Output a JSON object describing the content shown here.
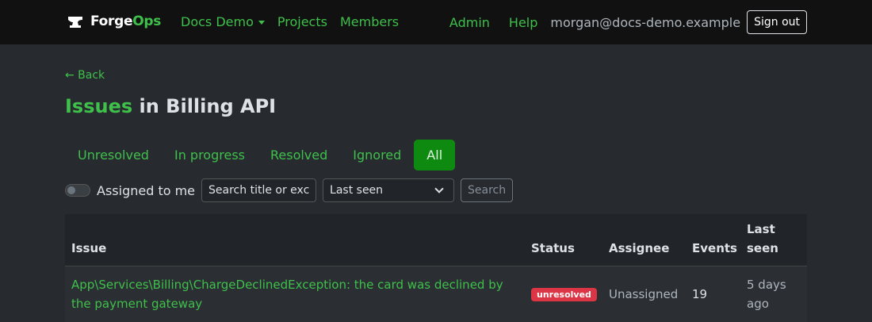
{
  "brand": {
    "name_a": "Forge",
    "name_b": "Ops"
  },
  "nav": {
    "workspace": "Docs Demo",
    "projects": "Projects",
    "members": "Members",
    "admin": "Admin",
    "help": "Help",
    "user_email": "morgan@docs-demo.example",
    "sign_out": "Sign out"
  },
  "back_label": "← Back",
  "title": {
    "highlight": "Issues",
    "rest": " in Billing API"
  },
  "tabs": [
    "Unresolved",
    "In progress",
    "Resolved",
    "Ignored",
    "All"
  ],
  "active_tab": "All",
  "filters": {
    "assigned_label": "Assigned to me",
    "search_placeholder": "Search title or exce",
    "sort_selected": "Last seen",
    "search_button": "Search"
  },
  "table": {
    "headers": {
      "issue": "Issue",
      "status": "Status",
      "assignee": "Assignee",
      "events": "Events",
      "last_seen_1": "Last",
      "last_seen_2": "seen"
    },
    "rows": [
      {
        "issue_line1": "App\\Services\\Billing\\ChargeDeclinedException: the card was declined by",
        "issue_line2": "the payment gateway",
        "status": "unresolved",
        "assignee": "Unassigned",
        "events": "19",
        "last_seen_1": "5 days",
        "last_seen_2": "ago"
      }
    ]
  },
  "colors": {
    "accent": "#3ec04a",
    "active_tab": "#0f8a10",
    "badge_danger": "#dc3545"
  }
}
